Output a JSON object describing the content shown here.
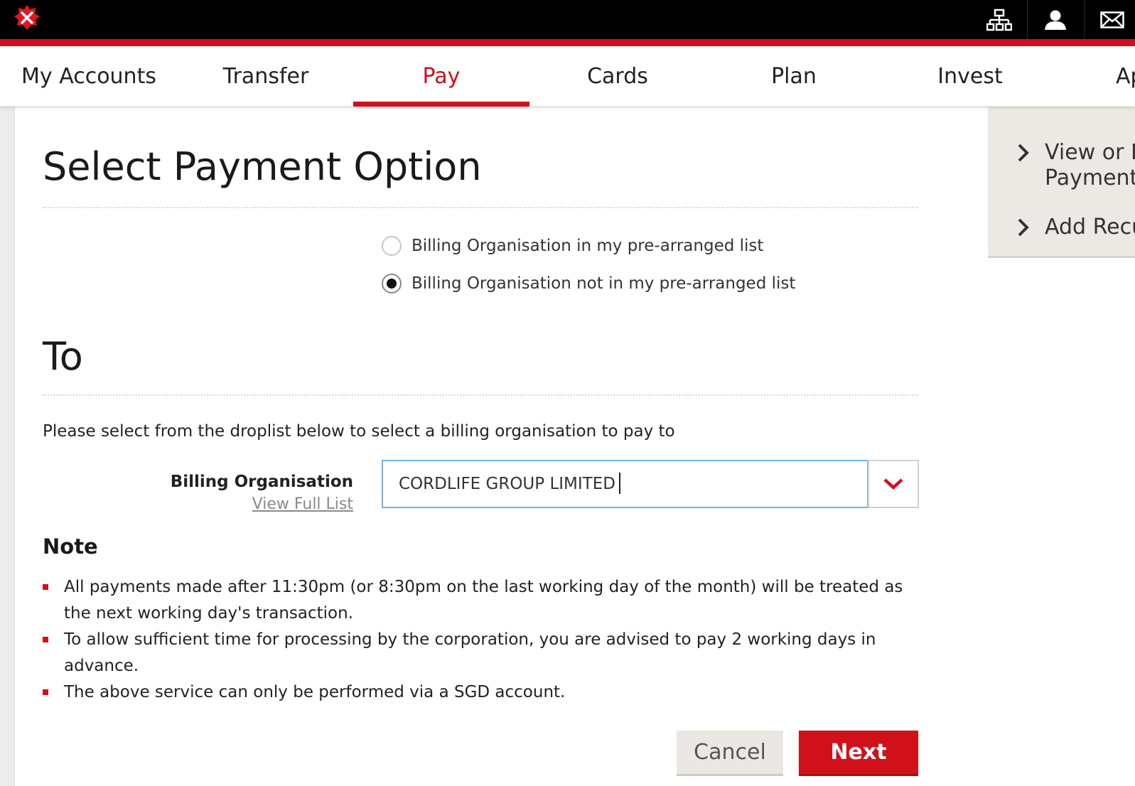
{
  "colors": {
    "brand_red": "#d0101a",
    "top_bar": "#000000",
    "sidebar_bg": "#ece9e4"
  },
  "header": {
    "logo_icon": "x-logo-icon",
    "icons": [
      "sitemap-icon",
      "user-icon",
      "mail-icon"
    ]
  },
  "nav": {
    "items": [
      {
        "label": "My Accounts"
      },
      {
        "label": "Transfer"
      },
      {
        "label": "Pay"
      },
      {
        "label": "Cards"
      },
      {
        "label": "Plan"
      },
      {
        "label": "Invest"
      },
      {
        "label": "Ap"
      }
    ],
    "active": "Pay"
  },
  "sidebar": {
    "items": [
      {
        "label": "View or D",
        "label2": "Payment"
      },
      {
        "label": "Add Recu"
      }
    ]
  },
  "page": {
    "title": "Select Payment Option",
    "options": [
      {
        "label": "Billing Organisation in my pre-arranged list",
        "checked": false
      },
      {
        "label": "Billing Organisation not in my pre-arranged list",
        "checked": true
      }
    ],
    "to_heading": "To",
    "instruction": "Please select from the droplist below to select a billing organisation to pay to",
    "billing_label": "Billing Organisation",
    "view_full_list": "View Full List",
    "billing_value": "CORDLIFE GROUP LIMITED",
    "note_title": "Note",
    "notes": [
      "All payments made after 11:30pm (or 8:30pm on the last working day of the month) will be treated as the next working day's transaction.",
      "To allow sufficient time for processing by the corporation, you are advised to pay 2 working days in advance.",
      "The above service can only be performed via a SGD account."
    ],
    "cancel_label": "Cancel",
    "next_label": "Next"
  }
}
